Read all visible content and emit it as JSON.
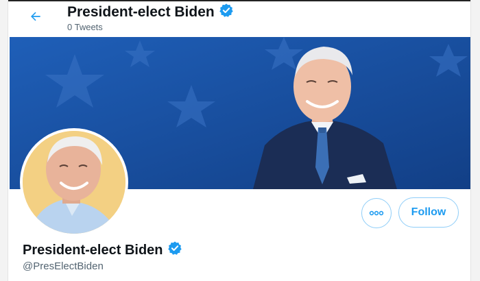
{
  "header": {
    "display_name": "President-elect Biden",
    "tweet_count": "0 Tweets",
    "back_icon": "arrow-left-icon",
    "verified_icon": "verified-badge-icon"
  },
  "profile": {
    "display_name": "President-elect Biden",
    "handle": "@PresElectBiden"
  },
  "actions": {
    "more_icon": "more-options-icon",
    "follow_label": "Follow"
  },
  "colors": {
    "accent": "#1d9bf0",
    "button_border": "#8ecdf8",
    "banner_blue": "#1a4f9c",
    "secondary_text": "#536471",
    "primary_text": "#0f1419"
  }
}
